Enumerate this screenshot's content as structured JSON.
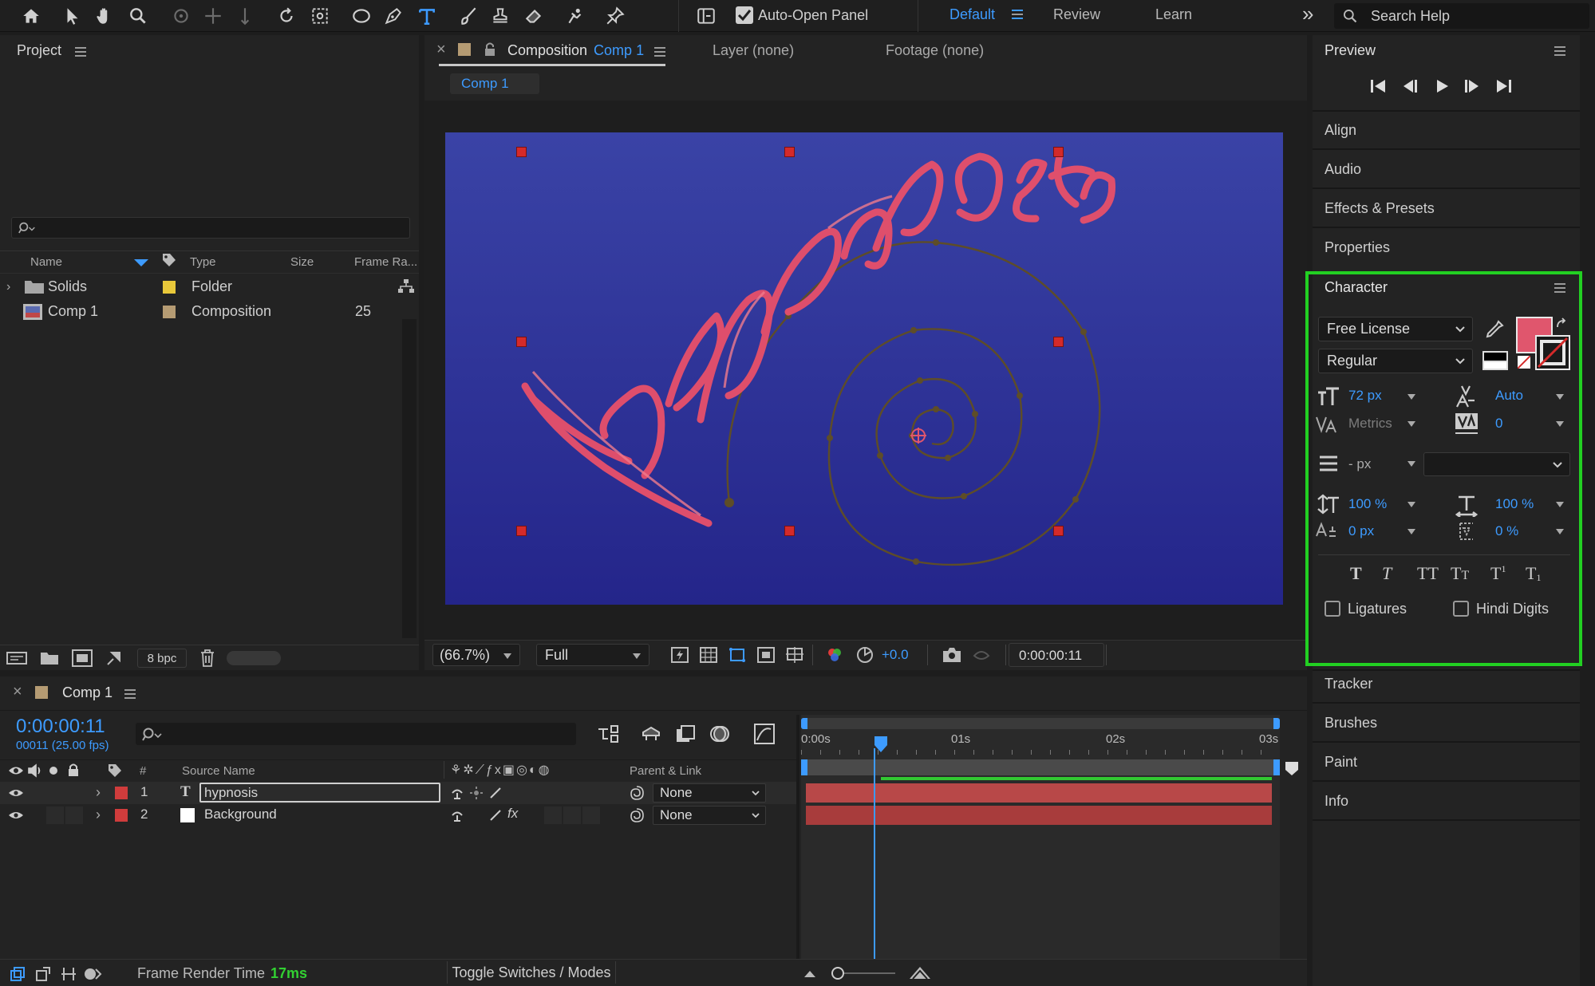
{
  "toolbar": {
    "auto_open_label": "Auto-Open Panel",
    "auto_open_checked": true,
    "workspaces": [
      "Default",
      "Review",
      "Learn"
    ],
    "active_workspace": "Default",
    "search_placeholder": "Search Help",
    "overflow": "»"
  },
  "project": {
    "title": "Project",
    "columns": [
      "Name",
      "Type",
      "Size",
      "Frame Ra..."
    ],
    "items": [
      {
        "name": "Solids",
        "type": "Folder",
        "size": "",
        "frame_rate": "",
        "label_color": "#e8c83a"
      },
      {
        "name": "Comp 1",
        "type": "Composition",
        "size": "",
        "frame_rate": "25",
        "label_color": "#b59b73"
      }
    ],
    "bpc": "8 bpc"
  },
  "composition": {
    "tab_prefix": "Composition",
    "tab_name": "Comp 1",
    "layer_tab": "Layer (none)",
    "footage_tab": "Footage (none)",
    "breadcrumb": "Comp 1",
    "text_content": "hypnosis",
    "zoom": "(66.7%)",
    "resolution": "Full",
    "exposure": "+0.0",
    "timecode": "0:00:00:11"
  },
  "right_panels": {
    "preview": "Preview",
    "items_top": [
      "Align",
      "Audio",
      "Effects & Presets",
      "Properties"
    ],
    "items_bottom": [
      "Tracker",
      "Brushes",
      "Paint",
      "Info"
    ]
  },
  "character": {
    "title": "Character",
    "font_family": "Free License",
    "font_style": "Regular",
    "fill_color": "#e0566d",
    "font_size": "72 px",
    "leading": "Auto",
    "kerning": "Metrics",
    "tracking": "0",
    "stroke_width": "- px",
    "vertical_scale": "100 %",
    "horizontal_scale": "100 %",
    "baseline_shift": "0 px",
    "tsume": "0 %",
    "ligatures_label": "Ligatures",
    "hindi_digits_label": "Hindi Digits",
    "highlight_color": "#22d022"
  },
  "timeline": {
    "tab": "Comp 1",
    "current_time": "0:00:00:11",
    "frame_info": "00011 (25.00 fps)",
    "col_num": "#",
    "col_source": "Source Name",
    "col_parent": "Parent & Link",
    "ruler": [
      "0:00s",
      "01s",
      "02s",
      "03s"
    ],
    "layers": [
      {
        "num": "1",
        "name": "hypnosis",
        "parent": "None",
        "label_color": "#d03c3c"
      },
      {
        "num": "2",
        "name": "Background",
        "parent": "None",
        "label_color": "#d03c3c"
      }
    ],
    "footer_label": "Frame Render Time",
    "render_time": "17ms",
    "toggle_label": "Toggle Switches / Modes"
  }
}
